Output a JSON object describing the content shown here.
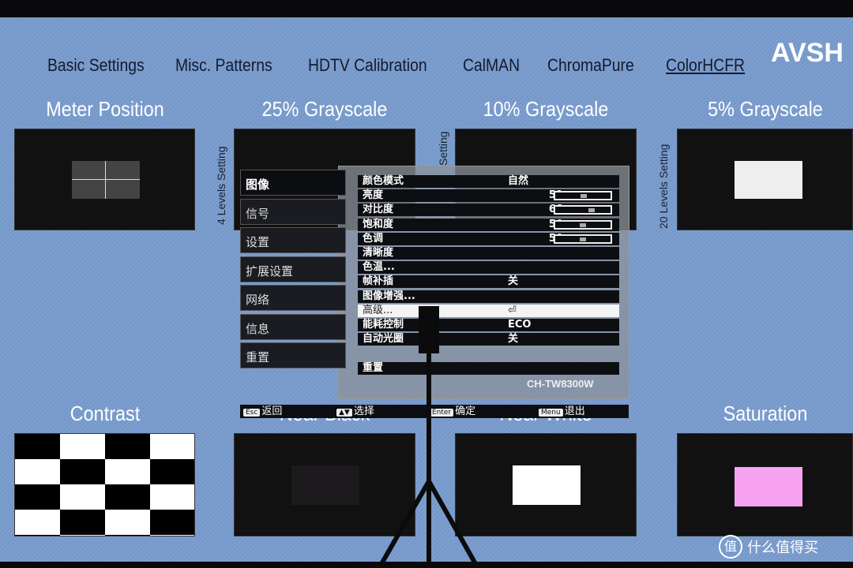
{
  "nav": [
    "Basic Settings",
    "Misc. Patterns",
    "HDTV Calibration",
    "CalMAN",
    "ChromaPure",
    "ColorHCFR"
  ],
  "logo": "AVSH",
  "top_titles": [
    "Meter Position",
    "25% Grayscale",
    "10% Grayscale",
    "5% Grayscale"
  ],
  "side_labels": [
    "4 Levels Setting",
    "Setting",
    "20 Levels Setting"
  ],
  "bottom_titles": [
    "Contrast",
    "Near Black",
    "Near White",
    "Saturation"
  ],
  "osd": {
    "left_menu": [
      "图像",
      "信号",
      "设置",
      "扩展设置",
      "网络",
      "信息",
      "重置"
    ],
    "rows": [
      {
        "label": "颜色模式",
        "value": "自然"
      },
      {
        "label": "亮度",
        "num": "51",
        "level": 51
      },
      {
        "label": "对比度",
        "num": "68",
        "level": 68
      },
      {
        "label": "饱和度",
        "num": "50",
        "level": 50
      },
      {
        "label": "色调",
        "num": "50",
        "level": 50
      },
      {
        "label": "清晰度"
      },
      {
        "label": "色温..."
      },
      {
        "label": "帧补插",
        "value": "关"
      },
      {
        "label": "图像增强..."
      },
      {
        "label": "高级...",
        "value": "⏎",
        "selected": true
      },
      {
        "label": "能耗控制",
        "value": "ECO"
      },
      {
        "label": "自动光圈",
        "value": "关"
      }
    ],
    "reset": "重置",
    "model": "CH-TW8300W",
    "footer": [
      {
        "key": "Esc",
        "text": "返回"
      },
      {
        "key": "▲▼",
        "text": "选择"
      },
      {
        "key": "Enter",
        "text": "确定"
      },
      {
        "key": "Menu",
        "text": "退出"
      }
    ]
  },
  "watermark": {
    "icon": "值",
    "text": "什么值得买"
  }
}
